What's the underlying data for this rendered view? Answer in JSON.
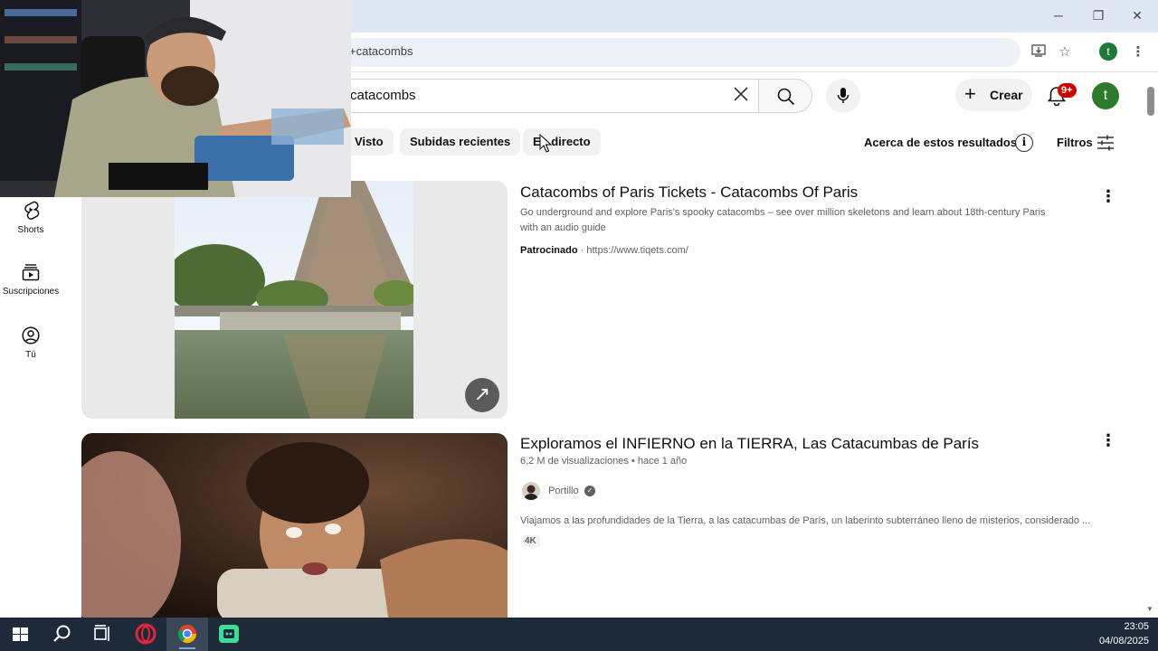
{
  "browser": {
    "url_text": "+catacombs",
    "window_controls": {
      "minimize": "─",
      "restore": "❐",
      "close": "✕"
    },
    "profile_initial": "t"
  },
  "youtube": {
    "search_query": "catacombs",
    "create_label": "Crear",
    "notifications_badge": "9+",
    "avatar_initial": "t",
    "chips": [
      "Visto",
      "Subidas recientes",
      "En directo"
    ],
    "about_results": "Acerca de estos resultados",
    "filters_label": "Filtros",
    "sidebar": [
      {
        "label": "Shorts",
        "icon": "shorts-icon"
      },
      {
        "label": "Suscripciones",
        "icon": "subscriptions-icon"
      },
      {
        "label": "Tú",
        "icon": "you-icon"
      }
    ],
    "ad_result": {
      "title": "Catacombs of Paris Tickets - Catacombs Of Paris",
      "description_line1": "Go underground and explore Paris's spooky catacombs – see over million skeletons and learn about 18th-century Paris",
      "description_line2": "with an audio guide",
      "sponsored_label": "Patrocinado",
      "separator": "·",
      "url": "https://www.tiqets.com/"
    },
    "video_result": {
      "title": "Exploramos el INFIERNO en la TIERRA, Las Catacumbas de París",
      "views": "6,2 M de visualizaciones",
      "age": "hace 1 año",
      "channel": "Portillo",
      "description": "Viajamos a las profundidades de la Tierra, a las catacumbas de París, un laberinto subterráneo lleno de misterios, considerado ...",
      "badge": "4K"
    }
  },
  "taskbar": {
    "time": "23:05",
    "date": "04/08/2025"
  }
}
